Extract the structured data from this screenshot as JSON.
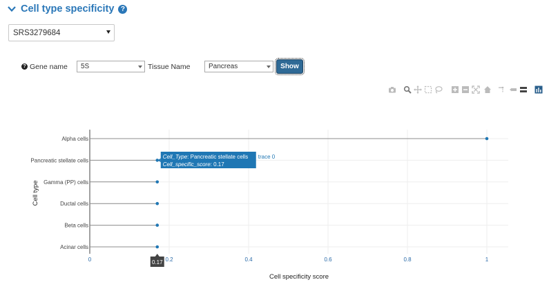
{
  "section": {
    "title": "Cell type specificity",
    "help_icon": "question-circle-icon",
    "toggle_icon": "chevron-down-icon"
  },
  "sample_select": {
    "value": "SRS3279684"
  },
  "form": {
    "help_icon": "question-circle-icon",
    "gene_label": "Gene name",
    "gene_value": "5S",
    "tissue_label": "Tissue Name",
    "tissue_value": "Pancreas",
    "show_label": "Show"
  },
  "modebar": {
    "icons": [
      "camera-icon",
      "zoom-icon",
      "pan-icon",
      "box-select-icon",
      "lasso-select-icon",
      "zoom-in-icon",
      "zoom-out-icon",
      "autoscale-icon",
      "reset-axes-icon",
      "spike-lines-icon",
      "hover-closest-icon",
      "hover-compare-icon",
      "plotly-logo-icon"
    ]
  },
  "colors": {
    "accent": "#2a77b8",
    "marker": "#1f77b4",
    "tooltip_bg": "#1f77b4",
    "stem": "#8c8c8c",
    "grid": "#eeeeee"
  },
  "chart_data": {
    "type": "scatter",
    "categories": [
      "Alpha cells",
      "Pancreatic stellate cells",
      "Gamma (PP) cells",
      "Ductal cells",
      "Beta cells",
      "Acinar cells"
    ],
    "values": [
      1,
      0.17,
      0.17,
      0.17,
      0.17,
      0.17
    ],
    "xlabel": "Cell specificity score",
    "ylabel": "Cell type",
    "xlim": [
      0,
      1.05
    ],
    "xticks": [
      0,
      0.2,
      0.4,
      0.6,
      0.8,
      1
    ],
    "xtick_labels": [
      "0",
      "0.2",
      "0.4",
      "0.6",
      "0.8",
      "1"
    ],
    "grid": true,
    "hover": {
      "category": "Pancreatic stellate cells",
      "value": 0.17,
      "label_type_key": "Cell_Type",
      "label_type_value": "Pancreatic stellate cells",
      "label_score_key": "Cell_specific_score",
      "label_score_value": "0.17",
      "trace_label": "trace 0",
      "x_flag": "0.17"
    }
  }
}
